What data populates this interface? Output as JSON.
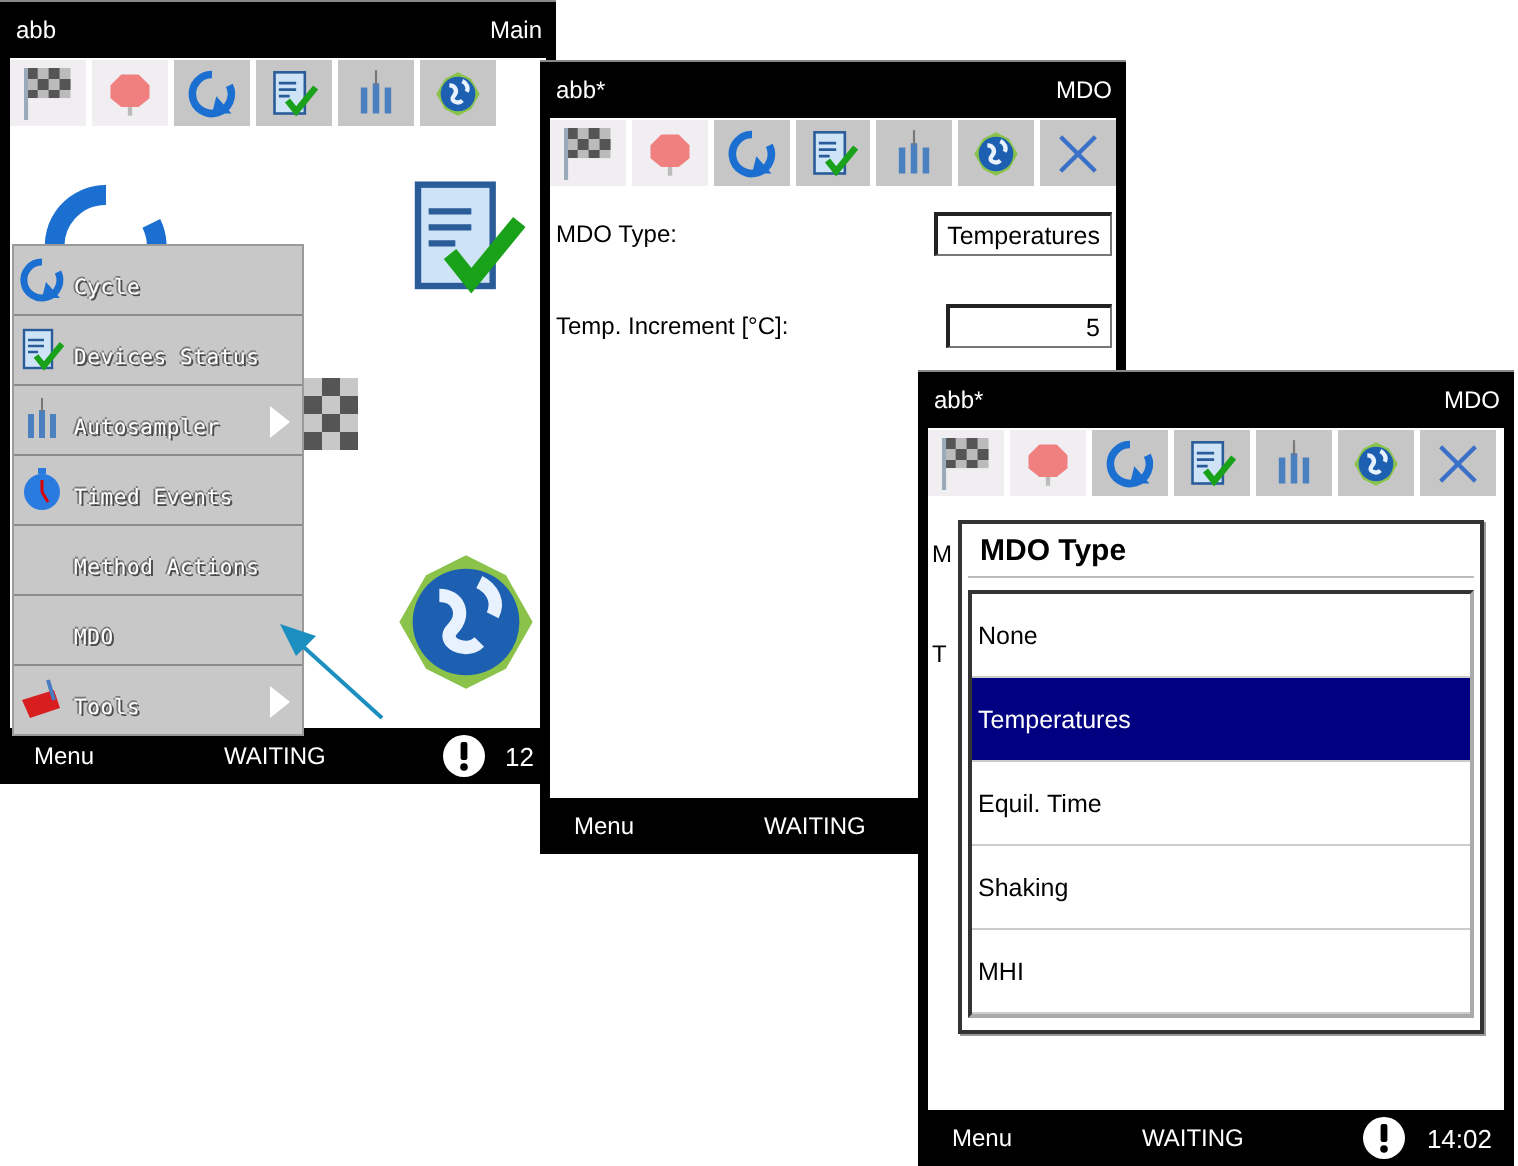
{
  "main_window": {
    "title": "abb",
    "screen": "Main",
    "toolbar": [
      {
        "kind": "flag",
        "disabled": true
      },
      {
        "kind": "stop",
        "disabled": true
      },
      {
        "kind": "cycle",
        "disabled": false
      },
      {
        "kind": "status",
        "disabled": false
      },
      {
        "kind": "sampler",
        "disabled": false
      },
      {
        "kind": "globe",
        "disabled": false
      }
    ],
    "tiles": [
      {
        "kind": "cycle"
      },
      {
        "kind": "status"
      },
      {
        "kind": "flag"
      },
      {
        "kind": "globe"
      }
    ],
    "menu": [
      {
        "label": "Cycle",
        "kind": "cycle",
        "submenu": false
      },
      {
        "label": "Devices Status",
        "kind": "status",
        "submenu": false
      },
      {
        "label": "Autosampler",
        "kind": "sampler",
        "submenu": true
      },
      {
        "label": "Timed Events",
        "kind": "timer",
        "submenu": false
      },
      {
        "label": "Method Actions",
        "kind": "plain",
        "submenu": false
      },
      {
        "label": "MDO",
        "kind": "plain",
        "submenu": false
      },
      {
        "label": "Tools",
        "kind": "tools",
        "submenu": true
      }
    ],
    "status_bar": {
      "menu": "Menu",
      "state": "WAITING",
      "time": "12"
    }
  },
  "mdo_window": {
    "title": "abb*",
    "screen": "MDO",
    "toolbar": [
      {
        "kind": "flag",
        "disabled": true
      },
      {
        "kind": "stop",
        "disabled": true
      },
      {
        "kind": "cycle",
        "disabled": false
      },
      {
        "kind": "status",
        "disabled": false
      },
      {
        "kind": "sampler",
        "disabled": false
      },
      {
        "kind": "globe",
        "disabled": false
      },
      {
        "kind": "close",
        "disabled": false
      }
    ],
    "fields": [
      {
        "kind": "select",
        "label": "MDO Type:",
        "value": "Temperatures"
      },
      {
        "kind": "number",
        "label": "Temp. Increment [°C]:",
        "value": "5"
      }
    ],
    "status_bar": {
      "menu": "Menu",
      "state": "WAITING"
    }
  },
  "mdo_dialog_window": {
    "title": "abb*",
    "screen": "MDO",
    "toolbar": [
      {
        "kind": "flag",
        "disabled": true
      },
      {
        "kind": "stop",
        "disabled": true
      },
      {
        "kind": "cycle",
        "disabled": false
      },
      {
        "kind": "status",
        "disabled": false
      },
      {
        "kind": "sampler",
        "disabled": false
      },
      {
        "kind": "globe",
        "disabled": false
      },
      {
        "kind": "close",
        "disabled": false
      }
    ],
    "covered_labels": [
      "M",
      "T"
    ],
    "dialog": {
      "title": "MDO Type",
      "options": [
        {
          "label": "None",
          "selected": false
        },
        {
          "label": "Temperatures",
          "selected": true
        },
        {
          "label": "Equil. Time",
          "selected": false
        },
        {
          "label": "Shaking",
          "selected": false
        },
        {
          "label": "MHI",
          "selected": false
        }
      ]
    },
    "status_bar": {
      "menu": "Menu",
      "state": "WAITING",
      "time": "14:02"
    }
  }
}
